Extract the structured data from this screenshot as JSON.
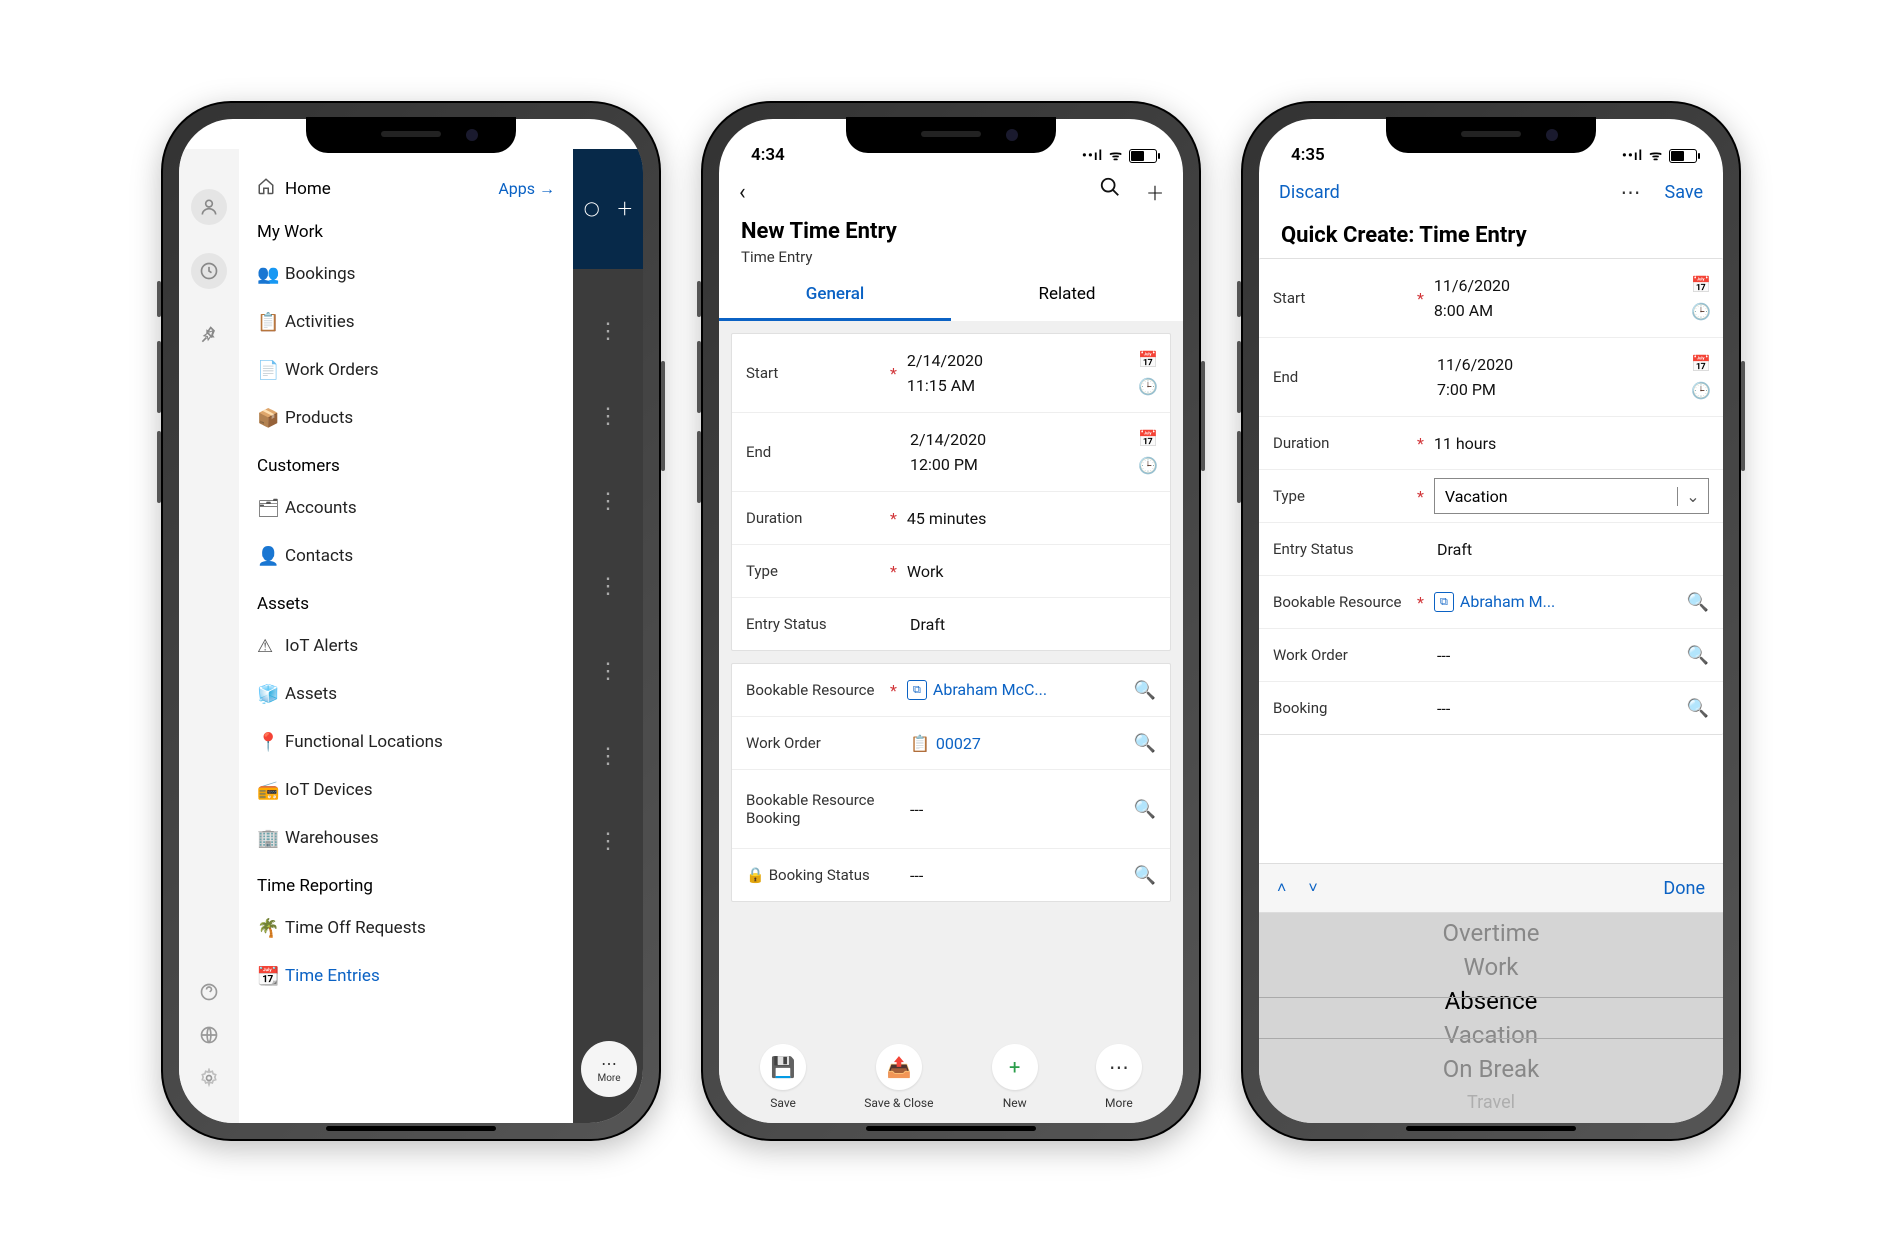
{
  "phone1": {
    "home": "Home",
    "apps": "Apps →",
    "sections": {
      "mywork": "My Work",
      "customers": "Customers",
      "assets": "Assets",
      "timereporting": "Time Reporting"
    },
    "items": {
      "bookings": "Bookings",
      "activities": "Activities",
      "workorders": "Work Orders",
      "products": "Products",
      "accounts": "Accounts",
      "contacts": "Contacts",
      "iotalerts": "IoT Alerts",
      "assets": "Assets",
      "funcloc": "Functional Locations",
      "iotdevices": "IoT Devices",
      "warehouses": "Warehouses",
      "timeoff": "Time Off Requests",
      "timeentries": "Time Entries"
    },
    "more": "More"
  },
  "phone2": {
    "time": "4:34",
    "title": "New Time Entry",
    "subtitle": "Time Entry",
    "tabs": {
      "general": "General",
      "related": "Related"
    },
    "fields": {
      "start": {
        "label": "Start",
        "date": "2/14/2020",
        "time": "11:15 AM"
      },
      "end": {
        "label": "End",
        "date": "2/14/2020",
        "time": "12:00 PM"
      },
      "duration": {
        "label": "Duration",
        "value": "45 minutes"
      },
      "type": {
        "label": "Type",
        "value": "Work"
      },
      "status": {
        "label": "Entry Status",
        "value": "Draft"
      },
      "resource": {
        "label": "Bookable Resource",
        "value": "Abraham McC..."
      },
      "workorder": {
        "label": "Work Order",
        "value": "00027"
      },
      "brb": {
        "label": "Bookable Resource Booking",
        "value": "---"
      },
      "bstatus": {
        "label": "Booking Status",
        "value": "---"
      }
    },
    "bottom": {
      "save": "Save",
      "saveclose": "Save & Close",
      "new": "New",
      "more": "More"
    }
  },
  "phone3": {
    "time": "4:35",
    "discard": "Discard",
    "save": "Save",
    "title": "Quick Create: Time Entry",
    "fields": {
      "start": {
        "label": "Start",
        "date": "11/6/2020",
        "time": "8:00 AM"
      },
      "end": {
        "label": "End",
        "date": "11/6/2020",
        "time": "7:00 PM"
      },
      "duration": {
        "label": "Duration",
        "value": "11 hours"
      },
      "type": {
        "label": "Type",
        "value": "Vacation"
      },
      "status": {
        "label": "Entry Status",
        "value": "Draft"
      },
      "resource": {
        "label": "Bookable Resource",
        "value": "Abraham M..."
      },
      "workorder": {
        "label": "Work Order",
        "value": "---"
      },
      "booking": {
        "label": "Booking",
        "value": "---"
      }
    },
    "done": "Done",
    "picker": [
      "Overtime",
      "Work",
      "Absence",
      "Vacation",
      "On Break",
      "Travel"
    ]
  }
}
